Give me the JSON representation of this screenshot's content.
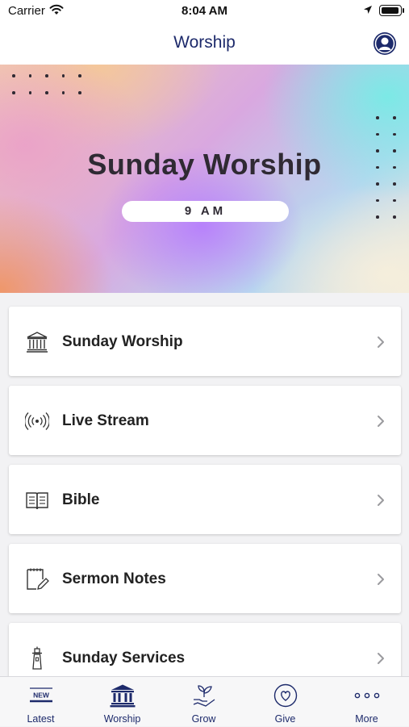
{
  "status_bar": {
    "carrier": "Carrier",
    "time": "8:04 AM"
  },
  "nav": {
    "title": "Worship"
  },
  "hero": {
    "title": "Sunday Worship",
    "time_label": "9 AM"
  },
  "menu": [
    {
      "label": "Sunday Worship",
      "icon": "church-building-icon"
    },
    {
      "label": "Live Stream",
      "icon": "broadcast-icon"
    },
    {
      "label": "Bible",
      "icon": "open-book-icon"
    },
    {
      "label": "Sermon Notes",
      "icon": "notepad-pencil-icon"
    },
    {
      "label": "Sunday Services",
      "icon": "lighthouse-icon"
    }
  ],
  "tabs": [
    {
      "label": "Latest",
      "icon": "new-badge-icon",
      "active": false
    },
    {
      "label": "Worship",
      "icon": "church-building-icon",
      "active": true
    },
    {
      "label": "Grow",
      "icon": "sprout-hand-icon",
      "active": false
    },
    {
      "label": "Give",
      "icon": "heart-circle-icon",
      "active": false
    },
    {
      "label": "More",
      "icon": "more-dots-icon",
      "active": false
    }
  ],
  "colors": {
    "accent": "#1d2a6b",
    "text": "#222222",
    "background": "#f2f2f4"
  }
}
